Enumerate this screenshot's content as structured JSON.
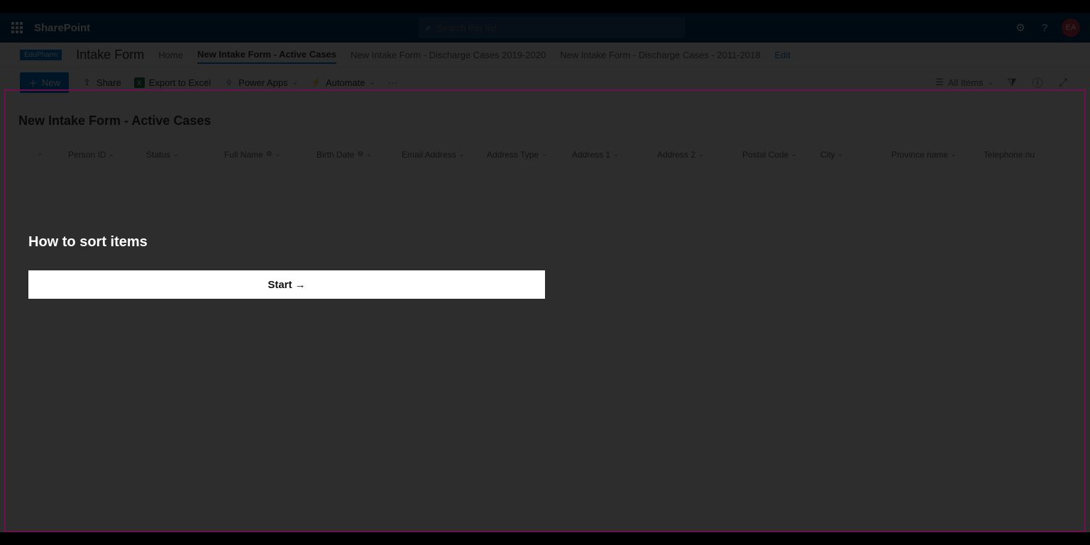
{
  "header": {
    "brand": "SharePoint",
    "search_placeholder": "Search this list",
    "avatar_initials": "EA"
  },
  "breadcrumb": {
    "site_badge": "EduPharm",
    "site_title": "Intake Form",
    "tabs": [
      {
        "label": "Home",
        "active": false
      },
      {
        "label": "New Intake Form - Active Cases",
        "active": true
      },
      {
        "label": "New Intake Form - Discharge Cases 2019-2020",
        "active": false
      },
      {
        "label": "New Intake Form - Discharge Cases - 2011-2018",
        "active": false
      }
    ],
    "edit_label": "Edit"
  },
  "cmdbar": {
    "new_label": "New",
    "share_label": "Share",
    "export_label": "Export to Excel",
    "powerapps_label": "Power Apps",
    "automate_label": "Automate",
    "more_label": "···",
    "view_label": "All Items"
  },
  "list": {
    "title": "New Intake Form - Active Cases",
    "columns": [
      "Person ID",
      "Status",
      "Full Name",
      "Birth Date",
      "Email Address",
      "Address Type",
      "Address 1",
      "Address 2",
      "Postal Code",
      "City",
      "Province name",
      "Telephone nu"
    ]
  },
  "tutorial": {
    "title": "How to sort items",
    "start_label": "Start →"
  }
}
